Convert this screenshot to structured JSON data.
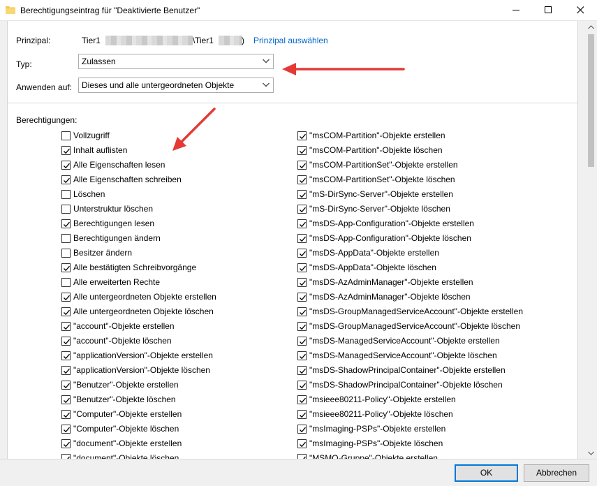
{
  "window": {
    "title": "Berechtigungseintrag für \"Deaktivierte Benutzer\""
  },
  "principal": {
    "label": "Prinzipal:",
    "value_part1": "Tier1",
    "value_sep": "\\",
    "value_part2": "Tier1",
    "value_end": ")",
    "select_link": "Prinzipal auswählen"
  },
  "type": {
    "label": "Typ:",
    "value": "Zulassen"
  },
  "apply_to": {
    "label": "Anwenden auf:",
    "value": "Dieses und alle untergeordneten Objekte"
  },
  "permissions": {
    "label": "Berechtigungen:",
    "left": [
      {
        "label": "Vollzugriff",
        "checked": false
      },
      {
        "label": "Inhalt auflisten",
        "checked": true
      },
      {
        "label": "Alle Eigenschaften lesen",
        "checked": true
      },
      {
        "label": "Alle Eigenschaften schreiben",
        "checked": true
      },
      {
        "label": "Löschen",
        "checked": false
      },
      {
        "label": "Unterstruktur löschen",
        "checked": false
      },
      {
        "label": "Berechtigungen lesen",
        "checked": true
      },
      {
        "label": "Berechtigungen ändern",
        "checked": false
      },
      {
        "label": "Besitzer ändern",
        "checked": false
      },
      {
        "label": "Alle bestätigten Schreibvorgänge",
        "checked": true
      },
      {
        "label": "Alle erweiterten Rechte",
        "checked": false
      },
      {
        "label": "Alle untergeordneten Objekte erstellen",
        "checked": true
      },
      {
        "label": "Alle untergeordneten Objekte löschen",
        "checked": true
      },
      {
        "label": "\"account\"-Objekte erstellen",
        "checked": true
      },
      {
        "label": "\"account\"-Objekte löschen",
        "checked": true
      },
      {
        "label": "\"applicationVersion\"-Objekte erstellen",
        "checked": true
      },
      {
        "label": "\"applicationVersion\"-Objekte löschen",
        "checked": true
      },
      {
        "label": "\"Benutzer\"-Objekte erstellen",
        "checked": true
      },
      {
        "label": "\"Benutzer\"-Objekte löschen",
        "checked": true
      },
      {
        "label": "\"Computer\"-Objekte erstellen",
        "checked": true
      },
      {
        "label": "\"Computer\"-Objekte löschen",
        "checked": true
      },
      {
        "label": "\"document\"-Objekte erstellen",
        "checked": true
      },
      {
        "label": "\"document\"-Objekte löschen",
        "checked": true
      }
    ],
    "right": [
      {
        "label": "\"msCOM-Partition\"-Objekte erstellen",
        "checked": true
      },
      {
        "label": "\"msCOM-Partition\"-Objekte löschen",
        "checked": true
      },
      {
        "label": "\"msCOM-PartitionSet\"-Objekte erstellen",
        "checked": true
      },
      {
        "label": "\"msCOM-PartitionSet\"-Objekte löschen",
        "checked": true
      },
      {
        "label": "\"mS-DirSync-Server\"-Objekte erstellen",
        "checked": true
      },
      {
        "label": "\"mS-DirSync-Server\"-Objekte löschen",
        "checked": true
      },
      {
        "label": "\"msDS-App-Configuration\"-Objekte erstellen",
        "checked": true
      },
      {
        "label": "\"msDS-App-Configuration\"-Objekte löschen",
        "checked": true
      },
      {
        "label": "\"msDS-AppData\"-Objekte erstellen",
        "checked": true
      },
      {
        "label": "\"msDS-AppData\"-Objekte löschen",
        "checked": true
      },
      {
        "label": "\"msDS-AzAdminManager\"-Objekte erstellen",
        "checked": true
      },
      {
        "label": "\"msDS-AzAdminManager\"-Objekte löschen",
        "checked": true
      },
      {
        "label": "\"msDS-GroupManagedServiceAccount\"-Objekte erstellen",
        "checked": true
      },
      {
        "label": "\"msDS-GroupManagedServiceAccount\"-Objekte löschen",
        "checked": true
      },
      {
        "label": "\"msDS-ManagedServiceAccount\"-Objekte erstellen",
        "checked": true
      },
      {
        "label": "\"msDS-ManagedServiceAccount\"-Objekte löschen",
        "checked": true
      },
      {
        "label": "\"msDS-ShadowPrincipalContainer\"-Objekte erstellen",
        "checked": true
      },
      {
        "label": "\"msDS-ShadowPrincipalContainer\"-Objekte löschen",
        "checked": true
      },
      {
        "label": "\"msieee80211-Policy\"-Objekte erstellen",
        "checked": true
      },
      {
        "label": "\"msieee80211-Policy\"-Objekte löschen",
        "checked": true
      },
      {
        "label": "\"msImaging-PSPs\"-Objekte erstellen",
        "checked": true
      },
      {
        "label": "\"msImaging-PSPs\"-Objekte löschen",
        "checked": true
      },
      {
        "label": "\"MSMQ-Gruppe\"-Objekte erstellen",
        "checked": true
      }
    ]
  },
  "buttons": {
    "ok": "OK",
    "cancel": "Abbrechen"
  },
  "icons": {
    "title": "folder-icon",
    "minimize": "minimize-icon",
    "maximize": "maximize-icon",
    "close": "close-icon",
    "dropdown": "chevron-down-icon",
    "check": "checkmark-icon"
  },
  "colors": {
    "link": "#0066cc",
    "annotation_arrow": "#e53935",
    "default_button_border": "#0078d7",
    "folder": "#f3c84b"
  }
}
